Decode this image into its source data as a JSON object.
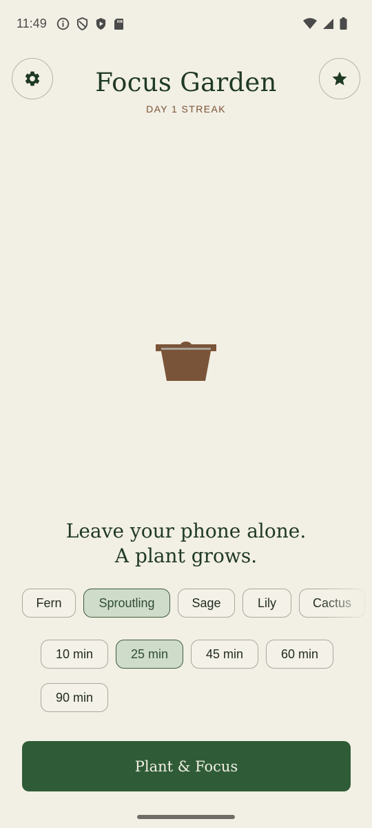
{
  "status_bar": {
    "time": "11:49",
    "left_icons": [
      "info-icon",
      "shield-icon",
      "play-protect-icon",
      "sd-card-icon"
    ],
    "right_icons": [
      "wifi-icon",
      "cell-signal-icon",
      "battery-icon"
    ]
  },
  "header": {
    "title": "Focus Garden",
    "streak": "DAY 1 STREAK",
    "left_button_icon": "gear-icon",
    "right_button_icon": "star-icon"
  },
  "tagline": {
    "line1": "Leave your phone alone.",
    "line2": "A plant grows."
  },
  "plants": [
    {
      "label": "Fern",
      "selected": false
    },
    {
      "label": "Sproutling",
      "selected": true
    },
    {
      "label": "Sage",
      "selected": false
    },
    {
      "label": "Lily",
      "selected": false
    },
    {
      "label": "Cactus",
      "selected": false
    }
  ],
  "durations": [
    {
      "label": "10 min",
      "selected": false
    },
    {
      "label": "25 min",
      "selected": true
    },
    {
      "label": "45 min",
      "selected": false
    },
    {
      "label": "60 min",
      "selected": false
    },
    {
      "label": "90 min",
      "selected": false
    }
  ],
  "cta": {
    "label": "Plant & Focus"
  },
  "colors": {
    "background": "#f2efe4",
    "primary": "#2f5c37",
    "title": "#1f3a23",
    "streak": "#7a5235",
    "selected_chip": "#cfdcca",
    "pot": "#7a5438"
  }
}
